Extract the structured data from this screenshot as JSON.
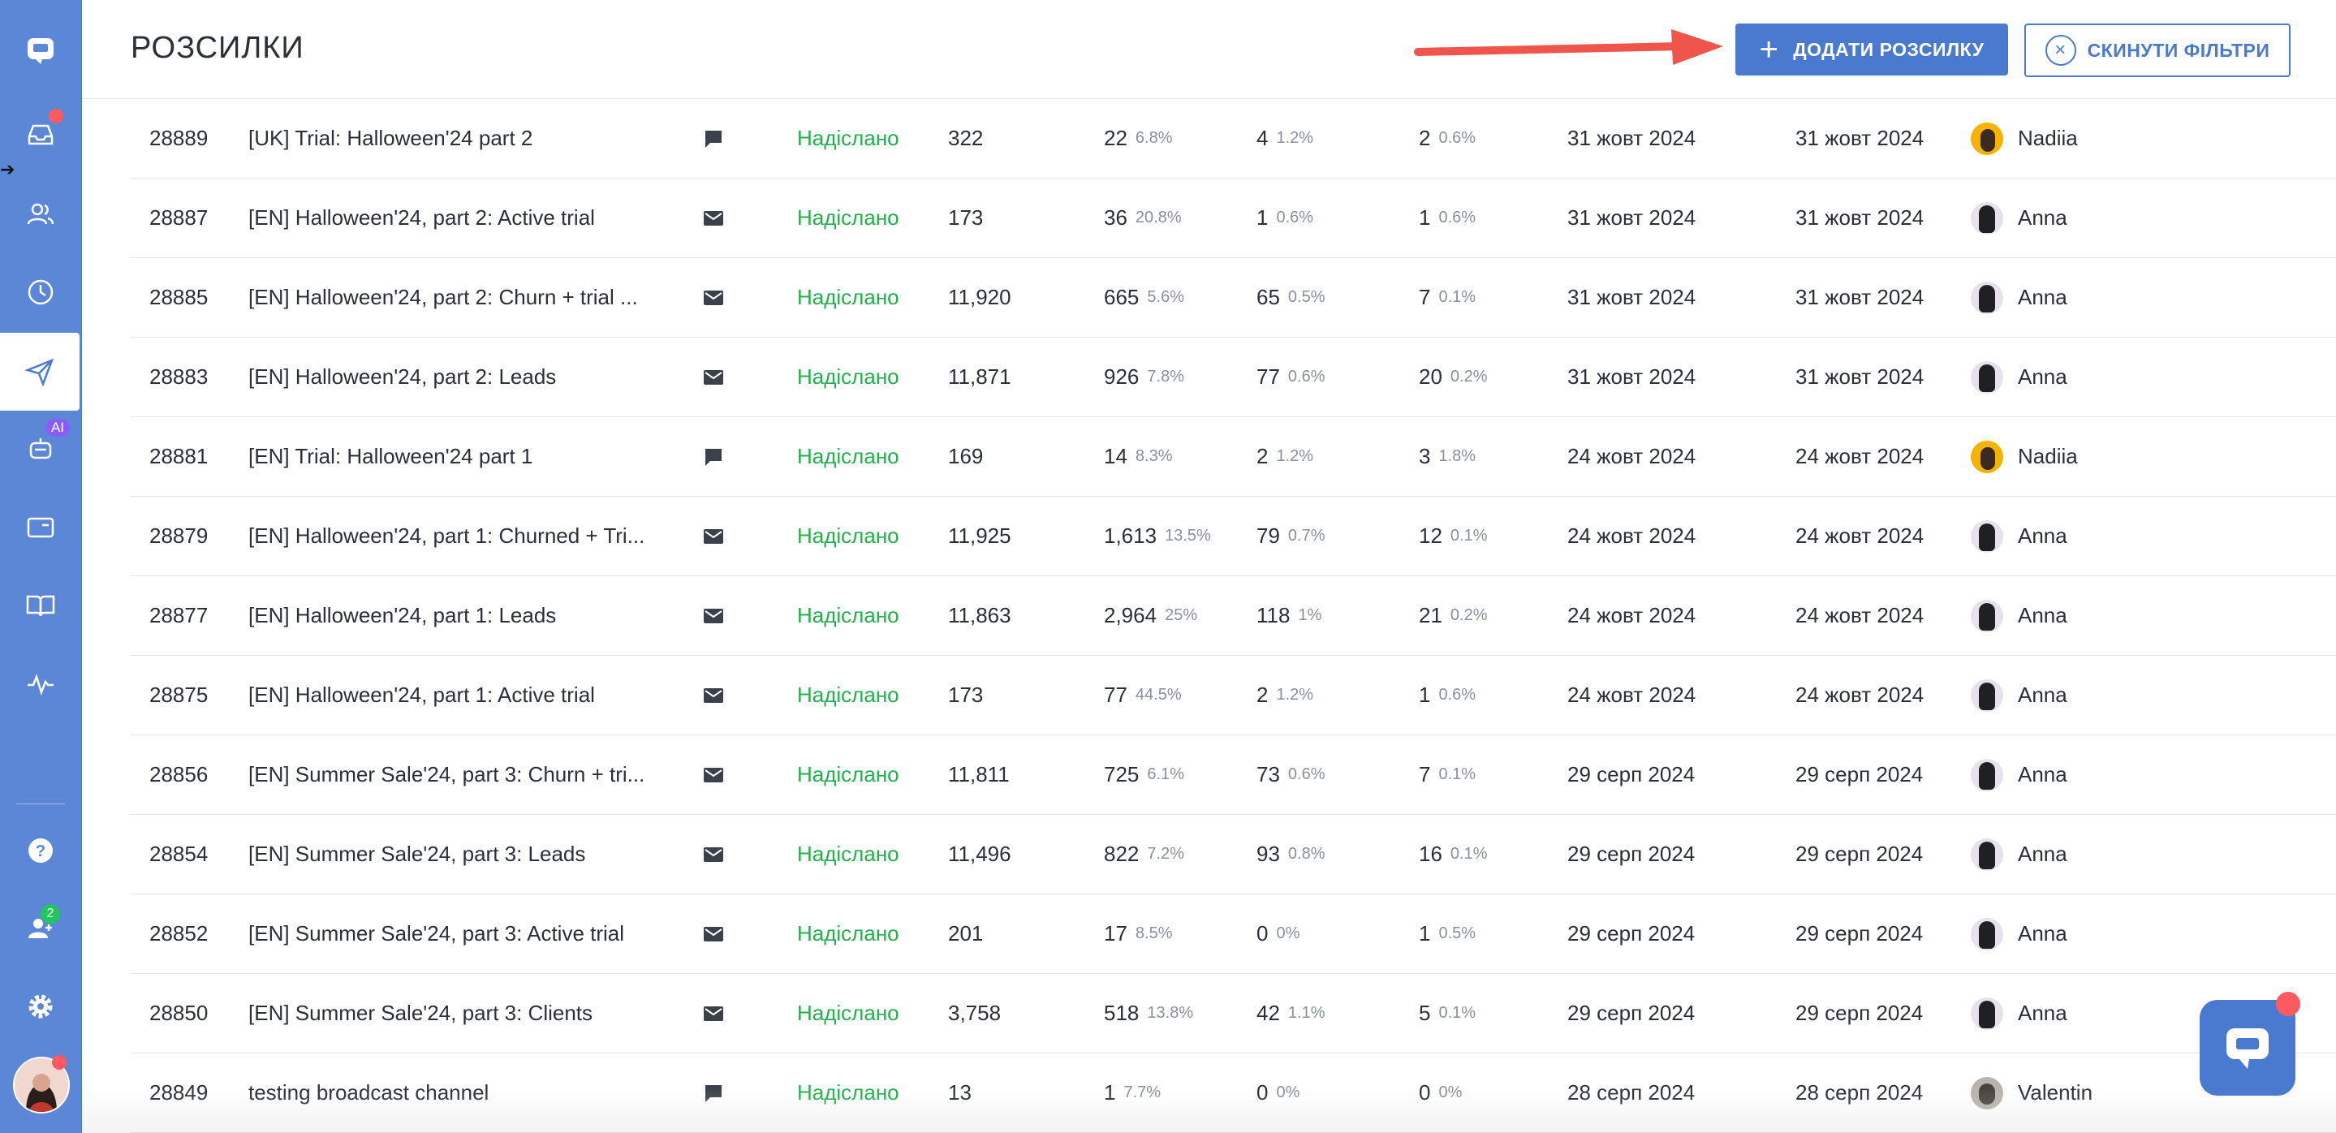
{
  "header": {
    "title": "РОЗСИЛКИ",
    "add_button": "ДОДАТИ РОЗСИЛКУ",
    "reset_button": "СКИНУТИ ФІЛЬТРИ"
  },
  "colors": {
    "sidebar": "#5c87d6",
    "primary": "#4a7ad0",
    "status_sent": "#22b04b",
    "notification": "#ff5a5f",
    "ai_badge": "#8b5cf6"
  },
  "sidebar": {
    "items": [
      {
        "name": "inbox-icon"
      },
      {
        "name": "users-icon"
      },
      {
        "name": "clock-icon"
      },
      {
        "name": "send-icon",
        "active": true
      },
      {
        "name": "bot-icon",
        "badge": "AI"
      },
      {
        "name": "card-icon"
      },
      {
        "name": "book-icon"
      },
      {
        "name": "pulse-icon"
      }
    ],
    "bottom": [
      {
        "name": "help-icon"
      },
      {
        "name": "team-icon",
        "badge": "2"
      },
      {
        "name": "gear-icon"
      }
    ]
  },
  "rows": [
    {
      "id": "28889",
      "name": "[UK] Trial: Halloween'24 part 2",
      "type": "chat",
      "status": "Надіслано",
      "sent": "322",
      "opened": "22",
      "opened_pct": "6.8%",
      "clicked": "4",
      "clicked_pct": "1.2%",
      "unsub": "2",
      "unsub_pct": "0.6%",
      "date1": "31 жовт 2024",
      "date2": "31 жовт 2024",
      "author": "Nadiia",
      "avatar": "orange"
    },
    {
      "id": "28887",
      "name": "[EN] Halloween'24, part 2: Active trial",
      "type": "email",
      "status": "Надіслано",
      "sent": "173",
      "opened": "36",
      "opened_pct": "20.8%",
      "clicked": "1",
      "clicked_pct": "0.6%",
      "unsub": "1",
      "unsub_pct": "0.6%",
      "date1": "31 жовт 2024",
      "date2": "31 жовт 2024",
      "author": "Anna",
      "avatar": "dark"
    },
    {
      "id": "28885",
      "name": "[EN] Halloween'24, part 2: Churn + trial ...",
      "type": "email",
      "status": "Надіслано",
      "sent": "11,920",
      "opened": "665",
      "opened_pct": "5.6%",
      "clicked": "65",
      "clicked_pct": "0.5%",
      "unsub": "7",
      "unsub_pct": "0.1%",
      "date1": "31 жовт 2024",
      "date2": "31 жовт 2024",
      "author": "Anna",
      "avatar": "dark"
    },
    {
      "id": "28883",
      "name": "[EN] Halloween'24, part 2: Leads",
      "type": "email",
      "status": "Надіслано",
      "sent": "11,871",
      "opened": "926",
      "opened_pct": "7.8%",
      "clicked": "77",
      "clicked_pct": "0.6%",
      "unsub": "20",
      "unsub_pct": "0.2%",
      "date1": "31 жовт 2024",
      "date2": "31 жовт 2024",
      "author": "Anna",
      "avatar": "dark"
    },
    {
      "id": "28881",
      "name": "[EN] Trial: Halloween'24 part 1",
      "type": "chat",
      "status": "Надіслано",
      "sent": "169",
      "opened": "14",
      "opened_pct": "8.3%",
      "clicked": "2",
      "clicked_pct": "1.2%",
      "unsub": "3",
      "unsub_pct": "1.8%",
      "date1": "24 жовт 2024",
      "date2": "24 жовт 2024",
      "author": "Nadiia",
      "avatar": "orange"
    },
    {
      "id": "28879",
      "name": "[EN] Halloween'24, part 1: Churned + Tri...",
      "type": "email",
      "status": "Надіслано",
      "sent": "11,925",
      "opened": "1,613",
      "opened_pct": "13.5%",
      "clicked": "79",
      "clicked_pct": "0.7%",
      "unsub": "12",
      "unsub_pct": "0.1%",
      "date1": "24 жовт 2024",
      "date2": "24 жовт 2024",
      "author": "Anna",
      "avatar": "dark"
    },
    {
      "id": "28877",
      "name": "[EN] Halloween'24, part 1: Leads",
      "type": "email",
      "status": "Надіслано",
      "sent": "11,863",
      "opened": "2,964",
      "opened_pct": "25%",
      "clicked": "118",
      "clicked_pct": "1%",
      "unsub": "21",
      "unsub_pct": "0.2%",
      "date1": "24 жовт 2024",
      "date2": "24 жовт 2024",
      "author": "Anna",
      "avatar": "dark"
    },
    {
      "id": "28875",
      "name": "[EN] Halloween'24, part 1: Active trial",
      "type": "email",
      "status": "Надіслано",
      "sent": "173",
      "opened": "77",
      "opened_pct": "44.5%",
      "clicked": "2",
      "clicked_pct": "1.2%",
      "unsub": "1",
      "unsub_pct": "0.6%",
      "date1": "24 жовт 2024",
      "date2": "24 жовт 2024",
      "author": "Anna",
      "avatar": "dark"
    },
    {
      "id": "28856",
      "name": "[EN] Summer Sale'24, part 3: Churn + tri...",
      "type": "email",
      "status": "Надіслано",
      "sent": "11,811",
      "opened": "725",
      "opened_pct": "6.1%",
      "clicked": "73",
      "clicked_pct": "0.6%",
      "unsub": "7",
      "unsub_pct": "0.1%",
      "date1": "29 серп 2024",
      "date2": "29 серп 2024",
      "author": "Anna",
      "avatar": "dark"
    },
    {
      "id": "28854",
      "name": "[EN] Summer Sale'24, part 3: Leads",
      "type": "email",
      "status": "Надіслано",
      "sent": "11,496",
      "opened": "822",
      "opened_pct": "7.2%",
      "clicked": "93",
      "clicked_pct": "0.8%",
      "unsub": "16",
      "unsub_pct": "0.1%",
      "date1": "29 серп 2024",
      "date2": "29 серп 2024",
      "author": "Anna",
      "avatar": "dark"
    },
    {
      "id": "28852",
      "name": "[EN] Summer Sale'24, part 3: Active trial",
      "type": "email",
      "status": "Надіслано",
      "sent": "201",
      "opened": "17",
      "opened_pct": "8.5%",
      "clicked": "0",
      "clicked_pct": "0%",
      "unsub": "1",
      "unsub_pct": "0.5%",
      "date1": "29 серп 2024",
      "date2": "29 серп 2024",
      "author": "Anna",
      "avatar": "dark"
    },
    {
      "id": "28850",
      "name": "[EN] Summer Sale'24, part 3: Clients",
      "type": "email",
      "status": "Надіслано",
      "sent": "3,758",
      "opened": "518",
      "opened_pct": "13.8%",
      "clicked": "42",
      "clicked_pct": "1.1%",
      "unsub": "5",
      "unsub_pct": "0.1%",
      "date1": "29 серп 2024",
      "date2": "29 серп 2024",
      "author": "Anna",
      "avatar": "dark"
    },
    {
      "id": "28849",
      "name": "testing broadcast channel",
      "type": "chat",
      "status": "Надіслано",
      "sent": "13",
      "opened": "1",
      "opened_pct": "7.7%",
      "clicked": "0",
      "clicked_pct": "0%",
      "unsub": "0",
      "unsub_pct": "0%",
      "date1": "28 серп 2024",
      "date2": "28 серп 2024",
      "author": "Valentin",
      "avatar": "grey"
    }
  ]
}
